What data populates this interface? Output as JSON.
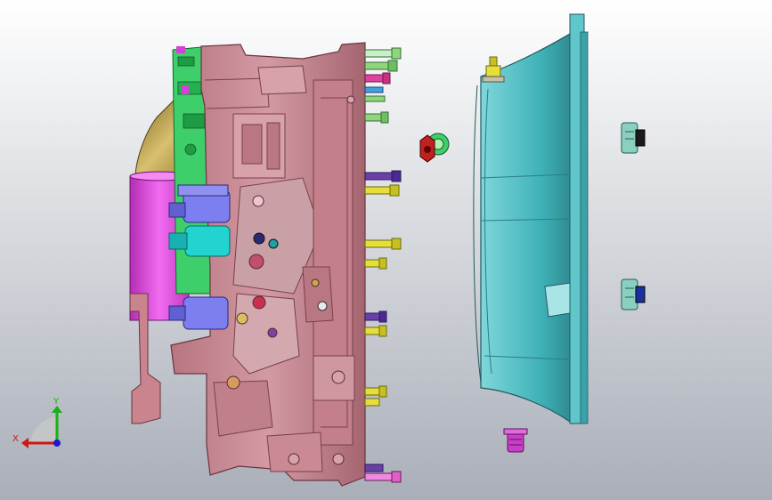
{
  "viewport": {
    "background_top": "#ffffff",
    "background_bottom": "#a9aeb8"
  },
  "colors": {
    "housing": "#c8848e",
    "housing_dark": "#8a4f59",
    "cover": "#4fb9bd",
    "cover_dark": "#2f7f86",
    "green_plate": "#3fcf6a",
    "magenta": "#d83ed8",
    "solenoid_blue": "#7d7ef0",
    "solenoid_cyan": "#22d3d0",
    "bolt_green": "#8fd67a",
    "bolt_yellow": "#e6df3a",
    "bolt_purple": "#6a40a8",
    "gold": "#b59a3a"
  },
  "triad": {
    "x_label": "X",
    "y_label": "Y",
    "x_color": "#d01818",
    "y_color": "#18b018",
    "z_color": "#1a1ad0"
  }
}
